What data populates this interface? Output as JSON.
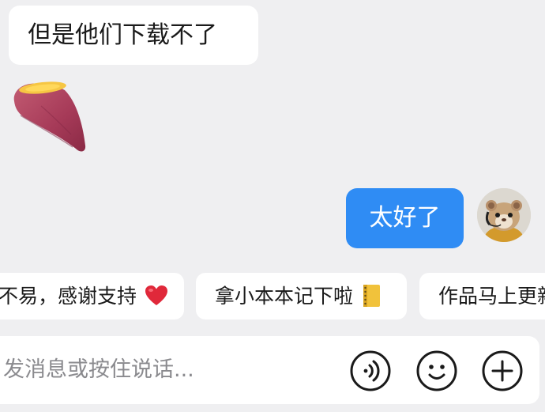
{
  "messages": {
    "received_text": "但是他们下载不了",
    "received_sticker": "sweet-potato-icon",
    "sent_text": "太好了"
  },
  "quick_replies": [
    {
      "label": "不易，感谢支持",
      "emoji": "heart-icon"
    },
    {
      "label": "拿小本本记下啦",
      "emoji": "notebook-icon"
    },
    {
      "label": "作品马上更新"
    }
  ],
  "input": {
    "placeholder": "发消息或按住说话..."
  },
  "colors": {
    "background": "#efeff1",
    "sent_bubble": "#2f8cf4",
    "received_bubble": "#ffffff"
  }
}
